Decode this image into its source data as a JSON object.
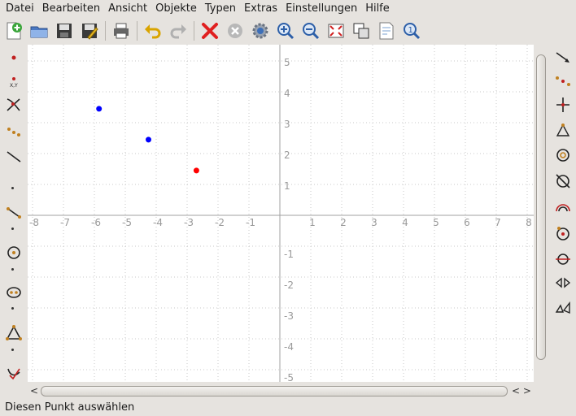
{
  "menubar": {
    "items": [
      "Datei",
      "Bearbeiten",
      "Ansicht",
      "Objekte",
      "Typen",
      "Extras",
      "Einstellungen",
      "Hilfe"
    ]
  },
  "toolbar": {
    "buttons": [
      {
        "icon": "new-document-icon"
      },
      {
        "icon": "open-folder-icon"
      },
      {
        "icon": "save-icon"
      },
      {
        "icon": "save-as-icon"
      },
      {
        "icon": "print-icon"
      },
      {
        "icon": "undo-icon"
      },
      {
        "icon": "redo-icon"
      },
      {
        "icon": "delete-icon"
      },
      {
        "icon": "cancel-icon"
      },
      {
        "icon": "settings-icon"
      },
      {
        "icon": "zoom-in-icon"
      },
      {
        "icon": "zoom-out-icon"
      },
      {
        "icon": "fit-to-page-icon"
      },
      {
        "icon": "view-icon"
      },
      {
        "icon": "properties-icon"
      },
      {
        "icon": "zoom-select-icon"
      }
    ]
  },
  "left_toolbar": {
    "tools": [
      "point-tool-icon",
      "coordinate-point-tool-icon",
      "intersection-tool-icon",
      "points-tool-icon",
      "line-tool-icon",
      "segment-tool-icon",
      "circle-tool-icon",
      "conic-tool-icon",
      "polygon-tool-icon",
      "transform-tool-icon"
    ]
  },
  "right_toolbar": {
    "tools": [
      "vector-tool-icon",
      "midpoint-tool-icon",
      "perpendicular-tool-icon",
      "triangle-tool-icon",
      "circle-center-tool-icon",
      "conic-intersect-tool-icon",
      "arc-tool-icon",
      "circle-point-tool-icon",
      "tangent-tool-icon",
      "mirror-tool-icon",
      "projection-tool-icon"
    ]
  },
  "canvas": {
    "x_tick_labels": [
      "-8",
      "-7",
      "-6",
      "-5",
      "-4",
      "-3",
      "-2",
      "-1",
      "1",
      "2",
      "3",
      "4",
      "5",
      "6",
      "7",
      "8"
    ],
    "y_tick_labels": [
      "5",
      "4",
      "3",
      "2",
      "1",
      "-1",
      "-2",
      "-3",
      "-4",
      "-5"
    ],
    "points": [
      {
        "x": -5.85,
        "y": 3.45,
        "color": "#0000ff"
      },
      {
        "x": -4.25,
        "y": 2.45,
        "color": "#0000ff"
      },
      {
        "x": -2.7,
        "y": 1.45,
        "color": "#ff0000"
      }
    ],
    "grid_color": "#c8c8c8",
    "axis_color": "#a0a0a0"
  },
  "scrollbars": {
    "h_left_arrow": "<",
    "h_right_arrows": "< >"
  },
  "statusbar": {
    "text": "Diesen Punkt auswählen"
  }
}
